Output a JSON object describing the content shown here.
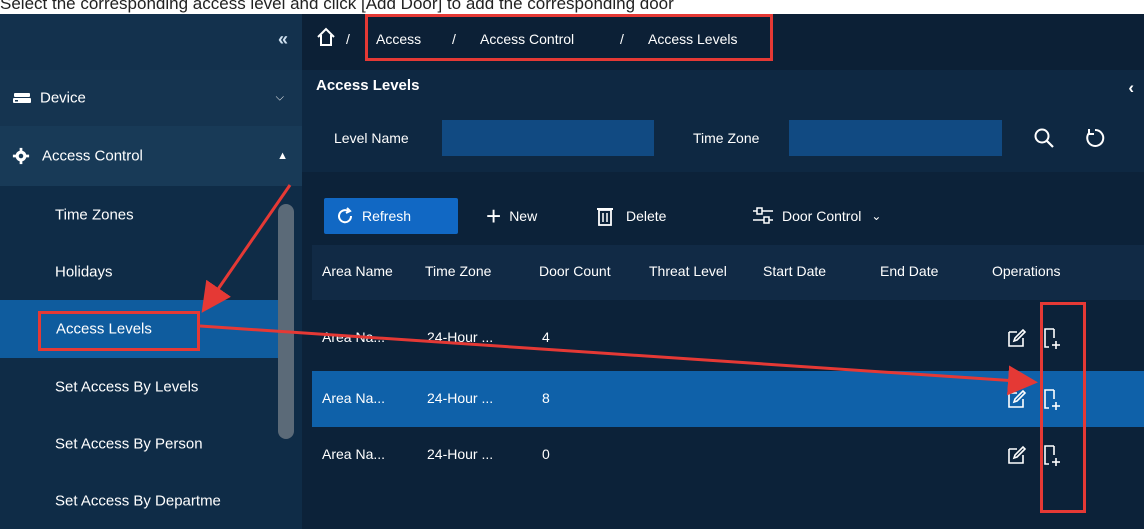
{
  "instruction_text": "Select the corresponding access level and click [Add Door] to add the corresponding door",
  "sidebar": {
    "collapse_label": "«",
    "items": [
      {
        "label": "Device"
      },
      {
        "label": "Access Control"
      }
    ],
    "sub_items": [
      {
        "label": "Time Zones"
      },
      {
        "label": "Holidays"
      },
      {
        "label": "Access Levels"
      },
      {
        "label": "Set Access By Levels"
      },
      {
        "label": "Set Access By Person"
      },
      {
        "label": "Set Access By Departme"
      }
    ]
  },
  "breadcrumb": {
    "items": [
      "Access",
      "Access Control",
      "Access Levels"
    ],
    "separator": "/"
  },
  "panel": {
    "title": "Access Levels",
    "collapse_label": "‹"
  },
  "filter": {
    "level_name_label": "Level Name",
    "time_zone_label": "Time Zone",
    "level_name_value": "",
    "time_zone_value": ""
  },
  "toolbar": {
    "refresh": "Refresh",
    "new": "New",
    "delete": "Delete",
    "door_control": "Door Control"
  },
  "table": {
    "columns": [
      "Area Name",
      "Time Zone",
      "Door Count",
      "Threat Level",
      "Start Date",
      "End Date",
      "Operations"
    ],
    "rows": [
      {
        "area": "Area Na...",
        "zone": "24-Hour ...",
        "count": "4",
        "selected": false
      },
      {
        "area": "Area Na...",
        "zone": "24-Hour ...",
        "count": "8",
        "selected": true
      },
      {
        "area": "Area Na...",
        "zone": "24-Hour ...",
        "count": "0",
        "selected": false
      }
    ]
  },
  "colors": {
    "sidebar": "#0f2c47",
    "active_item": "#0f5c9e",
    "accent_button": "#1168c4",
    "selected_row": "#0f61a9",
    "highlight": "#e53935"
  },
  "icons": [
    "home-icon",
    "device-icon",
    "gear-icon",
    "search-icon",
    "reset-icon",
    "refresh-icon",
    "plus-icon",
    "trash-icon",
    "door-control-icon",
    "edit-icon",
    "add-door-icon"
  ]
}
